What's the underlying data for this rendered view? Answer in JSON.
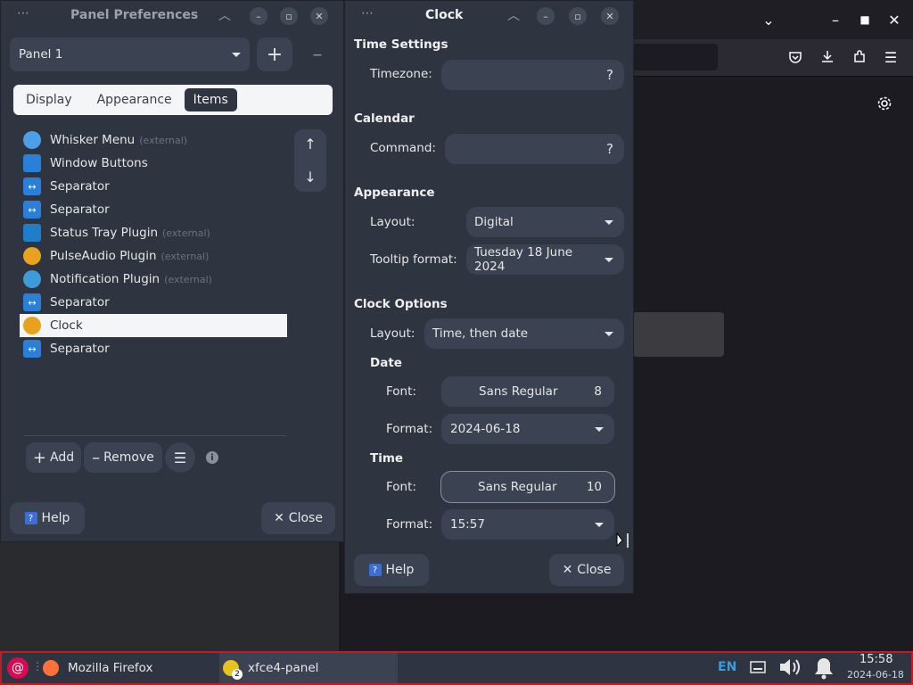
{
  "panel_prefs": {
    "title": "Panel Preferences",
    "panel_select": "Panel 1",
    "tabs": [
      {
        "label": "Display",
        "active": false
      },
      {
        "label": "Appearance",
        "active": false
      },
      {
        "label": "Items",
        "active": true
      }
    ],
    "items": [
      {
        "label": "Whisker Menu",
        "note": "(external)",
        "icon": "whisker-menu-icon",
        "color": "#4a9fe8"
      },
      {
        "label": "Window Buttons",
        "note": "",
        "icon": "window-buttons-icon",
        "color": "#2a7fd8"
      },
      {
        "label": "Separator",
        "note": "",
        "icon": "separator-icon",
        "color": "#2a7fd8"
      },
      {
        "label": "Separator",
        "note": "",
        "icon": "separator-icon",
        "color": "#2a7fd8"
      },
      {
        "label": "Status Tray Plugin",
        "note": "(external)",
        "icon": "status-tray-icon",
        "color": "#1e7fc8"
      },
      {
        "label": "PulseAudio Plugin",
        "note": "(external)",
        "icon": "pulseaudio-icon",
        "color": "#e8a21e"
      },
      {
        "label": "Notification Plugin",
        "note": "(external)",
        "icon": "notification-icon",
        "color": "#3d9bdc"
      },
      {
        "label": "Separator",
        "note": "",
        "icon": "separator-icon",
        "color": "#2a7fd8"
      },
      {
        "label": "Clock",
        "note": "",
        "icon": "clock-icon",
        "color": "#e8a21e",
        "selected": true
      },
      {
        "label": "Separator",
        "note": "",
        "icon": "separator-icon",
        "color": "#2a7fd8"
      }
    ],
    "add_label": "Add",
    "remove_label": "Remove",
    "help_label": "Help",
    "close_label": "Close"
  },
  "clock": {
    "title": "Clock",
    "time_settings": "Time Settings",
    "timezone_label": "Timezone:",
    "timezone_value": "",
    "calendar": "Calendar",
    "command_label": "Command:",
    "command_value": "",
    "appearance": "Appearance",
    "layout_label": "Layout:",
    "layout_value": "Digital",
    "tooltip_label": "Tooltip format:",
    "tooltip_value": "Tuesday 18 June 2024",
    "clock_options": "Clock Options",
    "co_layout_label": "Layout:",
    "co_layout_value": "Time, then date",
    "date": "Date",
    "date_font_label": "Font:",
    "date_font_name": "Sans Regular",
    "date_font_size": "8",
    "date_format_label": "Format:",
    "date_format_value": "2024-06-18",
    "time": "Time",
    "time_font_label": "Font:",
    "time_font_name": "Sans Regular",
    "time_font_size": "10",
    "time_format_label": "Format:",
    "time_format_value": "15:57",
    "help_label": "Help",
    "close_label": "Close",
    "question_mark": "?"
  },
  "taskbar": {
    "tasks": [
      {
        "label": "Mozilla Firefox",
        "active": false
      },
      {
        "label": "xfce4-panel",
        "active": true,
        "badge": "2"
      }
    ],
    "keyboard_layout": "EN",
    "time": "15:58",
    "date": "2024-06-18"
  },
  "colors": {
    "accent": "#c01c28",
    "window_bg": "#2e3440"
  }
}
